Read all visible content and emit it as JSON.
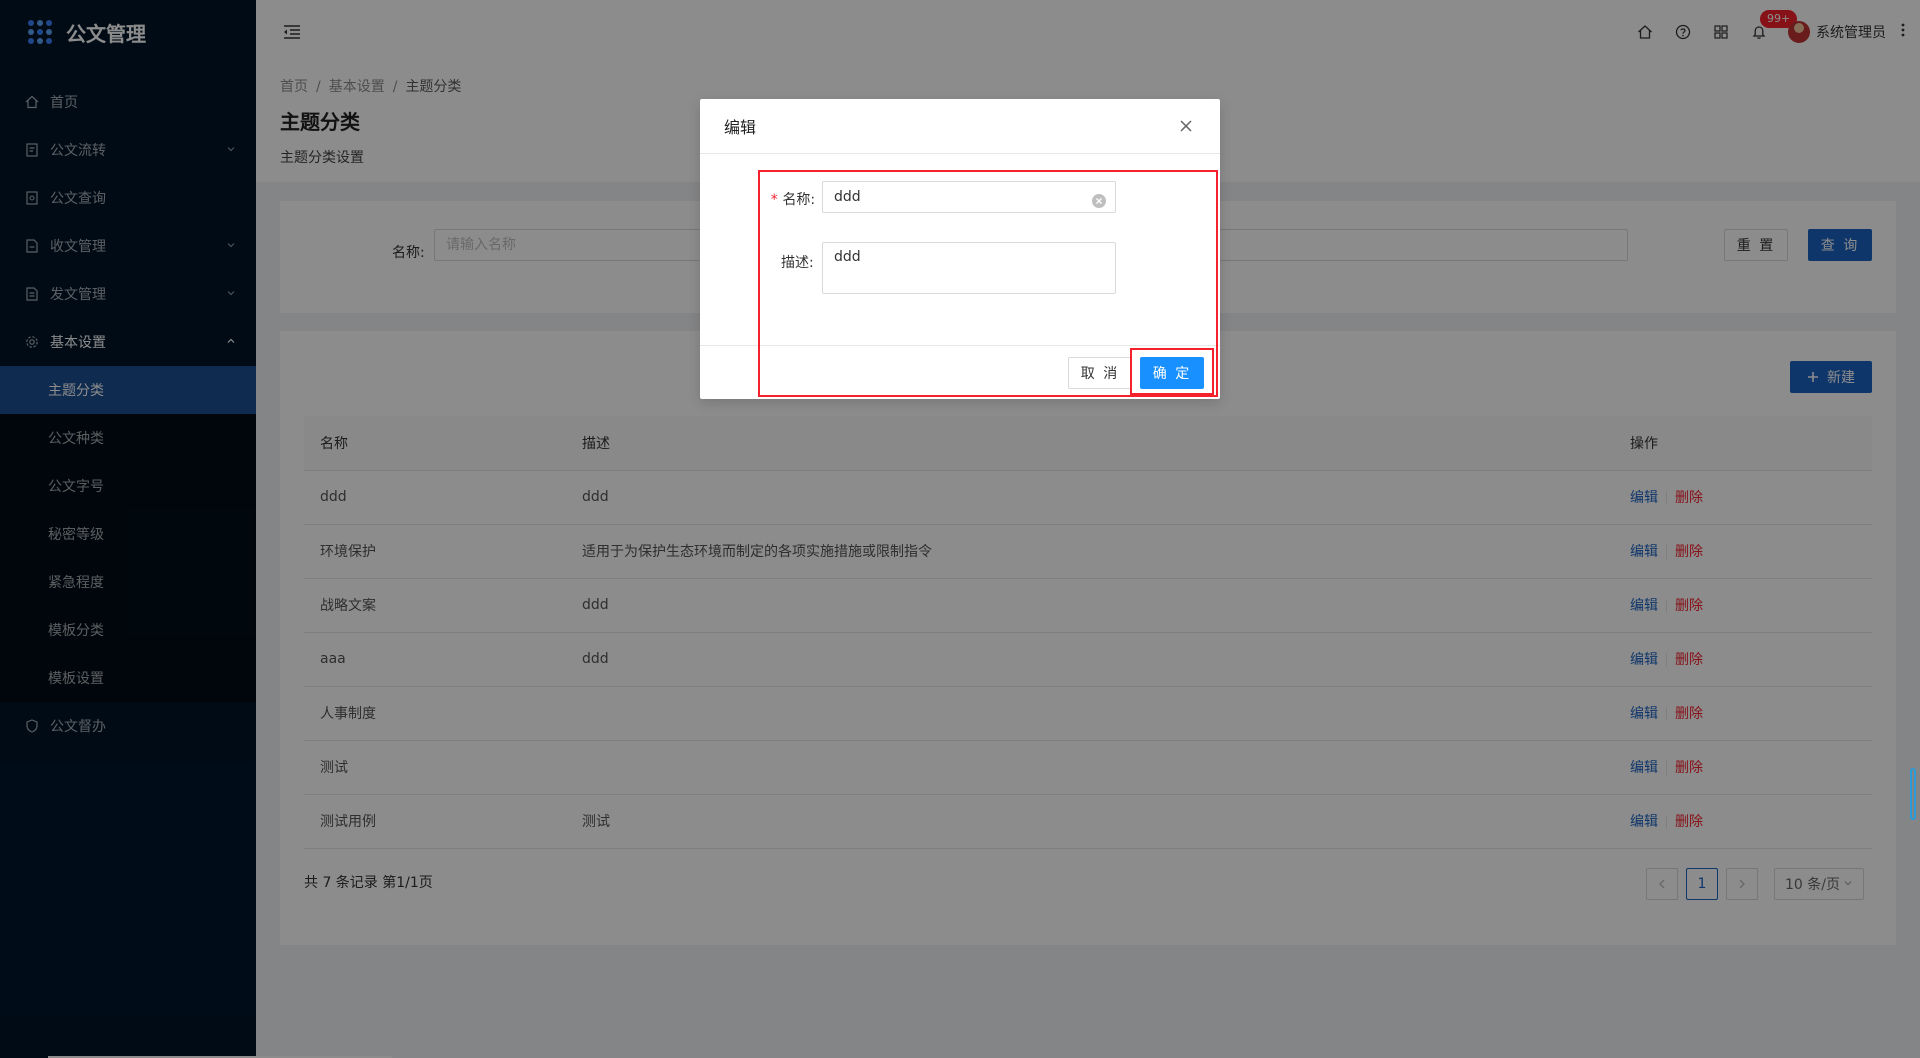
{
  "app": {
    "title": "公文管理"
  },
  "sidebar": {
    "items": [
      {
        "label": "首页",
        "icon": "home-icon"
      },
      {
        "label": "公文流转",
        "icon": "document-flow-icon"
      },
      {
        "label": "公文查询",
        "icon": "document-search-icon"
      },
      {
        "label": "收文管理",
        "icon": "inbox-document-icon"
      },
      {
        "label": "发文管理",
        "icon": "send-document-icon"
      },
      {
        "label": "基本设置",
        "icon": "gear-icon"
      },
      {
        "label": "公文督办",
        "icon": "shield-icon"
      }
    ],
    "submenu": [
      {
        "label": "主题分类",
        "active": true
      },
      {
        "label": "公文种类"
      },
      {
        "label": "公文字号"
      },
      {
        "label": "秘密等级"
      },
      {
        "label": "紧急程度"
      },
      {
        "label": "模板分类"
      },
      {
        "label": "模板设置"
      }
    ]
  },
  "header": {
    "badge": "99+",
    "user_name": "系统管理员"
  },
  "breadcrumb": [
    "首页",
    "基本设置",
    "主题分类"
  ],
  "page": {
    "title": "主题分类",
    "description": "主题分类设置"
  },
  "search": {
    "label": "名称:",
    "placeholder": "请输入名称",
    "reset_label": "重 置",
    "query_label": "查 询"
  },
  "table": {
    "new_label": "新建",
    "columns": [
      "名称",
      "描述",
      "操作"
    ],
    "edit_label": "编辑",
    "delete_label": "删除",
    "rows": [
      {
        "name": "ddd",
        "desc": "ddd"
      },
      {
        "name": "环境保护",
        "desc": "适用于为保护生态环境而制定的各项实施措施或限制指令"
      },
      {
        "name": "战略文案",
        "desc": "ddd"
      },
      {
        "name": "aaa",
        "desc": "ddd"
      },
      {
        "name": "人事制度",
        "desc": ""
      },
      {
        "name": "测试",
        "desc": ""
      },
      {
        "name": "测试用例",
        "desc": "测试"
      }
    ],
    "total_text": "共 7 条记录 第1/1页",
    "current_page": "1",
    "page_size": "10 条/页"
  },
  "modal": {
    "title": "编辑",
    "name_label": "名称:",
    "name_value": "ddd",
    "desc_label": "描述:",
    "desc_value": "ddd",
    "cancel_label": "取 消",
    "ok_label": "确 定"
  },
  "colors": {
    "sidebar_bg": "#001529",
    "primary": "#1d63c2",
    "modal_ok": "#1890ff",
    "danger": "#f5222d",
    "highlight": "#f5222d"
  }
}
